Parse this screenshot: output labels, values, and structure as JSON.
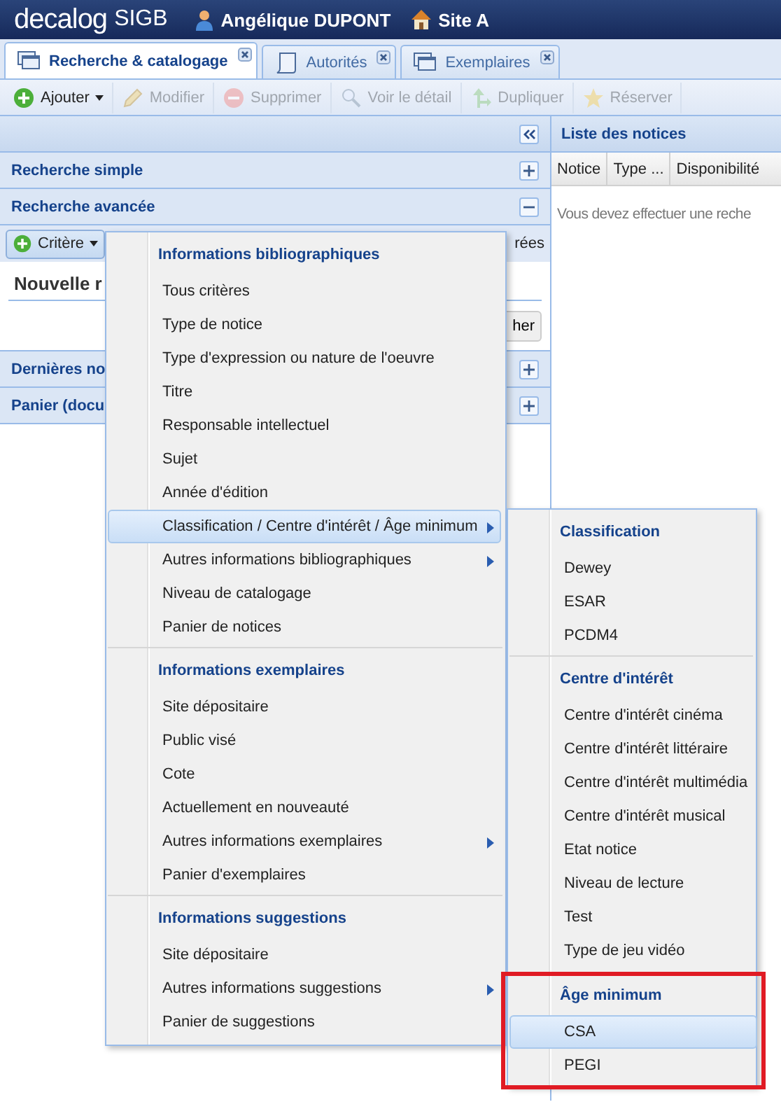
{
  "header": {
    "brand": "decalog",
    "product": "SIGB",
    "user": "Angélique DUPONT",
    "site": "Site A"
  },
  "tabs": [
    {
      "label": "Recherche & catalogage",
      "kind": "records",
      "selected": true
    },
    {
      "label": "Autorités",
      "kind": "authorities",
      "selected": false
    },
    {
      "label": "Exemplaires",
      "kind": "records",
      "selected": false
    }
  ],
  "toolbar": [
    {
      "label": "Ajouter",
      "kind": "add",
      "disabled": false,
      "dropdown": true
    },
    {
      "label": "Modifier",
      "kind": "edit",
      "disabled": true,
      "dropdown": false
    },
    {
      "label": "Supprimer",
      "kind": "delete",
      "disabled": true,
      "dropdown": false
    },
    {
      "label": "Voir le détail",
      "kind": "view",
      "disabled": true,
      "dropdown": false
    },
    {
      "label": "Dupliquer",
      "kind": "duplicate",
      "disabled": true,
      "dropdown": false
    },
    {
      "label": "Réserver",
      "kind": "reserve",
      "disabled": true,
      "dropdown": false
    }
  ],
  "sections": [
    {
      "title": "Recherche simple",
      "expanded": false
    },
    {
      "title": "Recherche avancée",
      "expanded": true
    },
    {
      "title": "Dernières no",
      "expanded": false
    },
    {
      "title": "Panier (docu",
      "expanded": false
    }
  ],
  "advanced": {
    "criteria_button": "Critère",
    "trailing_text": "rées",
    "query_title": "Nouvelle r",
    "action_button": "her"
  },
  "results": {
    "title": "Liste des notices",
    "columns": [
      "Notice",
      "Type ...",
      "Disponibilité"
    ],
    "empty_message": "Vous devez effectuer une reche"
  },
  "criteria_menu": [
    {
      "title": "Informations bibliographiques",
      "items": [
        {
          "label": "Tous critères",
          "submenu": false,
          "selected": false
        },
        {
          "label": "Type de notice",
          "submenu": false,
          "selected": false
        },
        {
          "label": "Type d'expression ou nature de l'oeuvre",
          "submenu": false,
          "selected": false
        },
        {
          "label": "Titre",
          "submenu": false,
          "selected": false
        },
        {
          "label": "Responsable intellectuel",
          "submenu": false,
          "selected": false
        },
        {
          "label": "Sujet",
          "submenu": false,
          "selected": false
        },
        {
          "label": "Année d'édition",
          "submenu": false,
          "selected": false
        },
        {
          "label": "Classification / Centre d'intérêt / Âge minimum",
          "submenu": true,
          "selected": true
        },
        {
          "label": "Autres informations bibliographiques",
          "submenu": true,
          "selected": false
        },
        {
          "label": "Niveau de catalogage",
          "submenu": false,
          "selected": false
        },
        {
          "label": "Panier de notices",
          "submenu": false,
          "selected": false
        }
      ]
    },
    {
      "title": "Informations exemplaires",
      "items": [
        {
          "label": "Site dépositaire",
          "submenu": false,
          "selected": false
        },
        {
          "label": "Public visé",
          "submenu": false,
          "selected": false
        },
        {
          "label": "Cote",
          "submenu": false,
          "selected": false
        },
        {
          "label": "Actuellement en nouveauté",
          "submenu": false,
          "selected": false
        },
        {
          "label": "Autres informations exemplaires",
          "submenu": true,
          "selected": false
        },
        {
          "label": "Panier d'exemplaires",
          "submenu": false,
          "selected": false
        }
      ]
    },
    {
      "title": "Informations suggestions",
      "items": [
        {
          "label": "Site dépositaire",
          "submenu": false,
          "selected": false
        },
        {
          "label": "Autres informations suggestions",
          "submenu": true,
          "selected": false
        },
        {
          "label": "Panier de suggestions",
          "submenu": false,
          "selected": false
        }
      ]
    }
  ],
  "submenu": [
    {
      "title": "Classification",
      "highlighted": false,
      "items": [
        {
          "label": "Dewey",
          "selected": false
        },
        {
          "label": "ESAR",
          "selected": false
        },
        {
          "label": "PCDM4",
          "selected": false
        }
      ]
    },
    {
      "title": "Centre d'intérêt",
      "highlighted": false,
      "items": [
        {
          "label": "Centre d'intérêt cinéma",
          "selected": false
        },
        {
          "label": "Centre d'intérêt littéraire",
          "selected": false
        },
        {
          "label": "Centre d'intérêt multimédia",
          "selected": false
        },
        {
          "label": "Centre d'intérêt musical",
          "selected": false
        },
        {
          "label": "Etat notice",
          "selected": false
        },
        {
          "label": "Niveau de lecture",
          "selected": false
        },
        {
          "label": "Test",
          "selected": false
        },
        {
          "label": "Type de jeu vidéo",
          "selected": false
        }
      ]
    },
    {
      "title": "Âge minimum",
      "highlighted": true,
      "items": [
        {
          "label": "CSA",
          "selected": true
        },
        {
          "label": "PEGI",
          "selected": false
        }
      ]
    }
  ]
}
